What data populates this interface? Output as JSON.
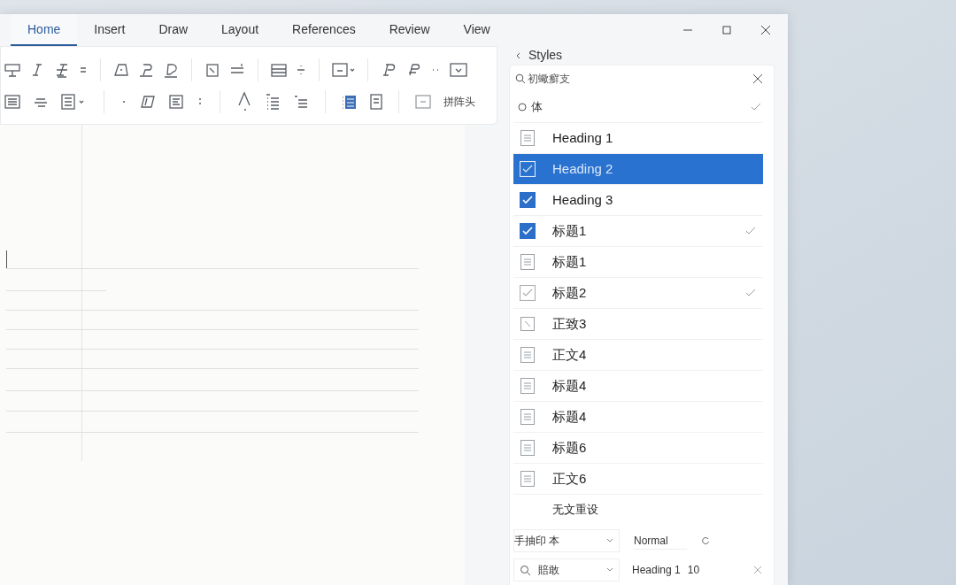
{
  "tabs": [
    {
      "label": "Home",
      "selected": true
    },
    {
      "label": "Insert",
      "selected": false
    },
    {
      "label": "Draw",
      "selected": false
    },
    {
      "label": "Layout",
      "selected": false
    },
    {
      "label": "References",
      "selected": false
    },
    {
      "label": "Review",
      "selected": false
    },
    {
      "label": "View",
      "selected": false
    }
  ],
  "ribbon": {
    "label": "拼阵头"
  },
  "styles_pane": {
    "title": "Styles",
    "search": {
      "placeholder": "初蠍癬支"
    },
    "filter": {
      "label": "体"
    },
    "items": [
      {
        "label": "Heading 1",
        "kind": "document",
        "selected": false,
        "marked": false
      },
      {
        "label": "Heading 2",
        "kind": "check-outline",
        "selected": true,
        "marked": false
      },
      {
        "label": "Heading 3",
        "kind": "check-filled",
        "selected": false,
        "marked": false
      },
      {
        "label": "标题1",
        "kind": "check-filled",
        "selected": false,
        "marked": true
      },
      {
        "label": "标题1",
        "kind": "document",
        "selected": false,
        "marked": false
      },
      {
        "label": "标题2",
        "kind": "check-outline",
        "selected": false,
        "marked": true
      },
      {
        "label": "正致3",
        "kind": "pencil",
        "selected": false,
        "marked": false
      },
      {
        "label": "正文4",
        "kind": "document",
        "selected": false,
        "marked": false
      },
      {
        "label": "标题4",
        "kind": "document",
        "selected": false,
        "marked": false
      },
      {
        "label": "标题4",
        "kind": "document",
        "selected": false,
        "marked": false
      },
      {
        "label": "标题6",
        "kind": "document",
        "selected": false,
        "marked": false
      },
      {
        "label": "正文6",
        "kind": "document",
        "selected": false,
        "marked": false
      },
      {
        "label": "无文重设",
        "kind": "plain",
        "selected": false,
        "marked": false
      }
    ],
    "controls": {
      "font_dropdown": "手抽印 本",
      "style_value": "Normal",
      "search_dropdown": "賠敢",
      "heading_value": "Heading 1",
      "size_value": "10"
    }
  }
}
